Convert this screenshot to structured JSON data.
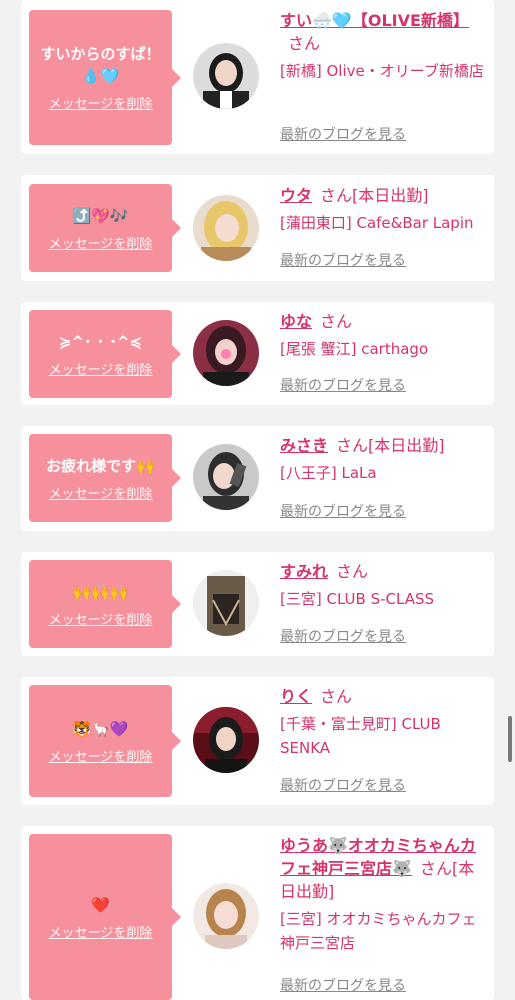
{
  "cards": [
    {
      "message": "すいからのすぱ！💧🩵",
      "delete_label": "メッセージを削除",
      "name": "すい🌨️🩵【OLIVE新橋】",
      "honorific": "さん",
      "tag": "",
      "shop": "[新橋] Olive・オリーブ新橋店",
      "blog_label": "最新のブログを見る"
    },
    {
      "message": "⤴️💖🎶",
      "delete_label": "メッセージを削除",
      "name": "ウタ",
      "honorific": "さん",
      "tag": "[本日出勤]",
      "shop": "[蒲田東口] Cafe&Bar Lapin",
      "blog_label": "最新のブログを見る"
    },
    {
      "message": "≽^･ ･ ･^≼",
      "delete_label": "メッセージを削除",
      "name": "ゆな",
      "honorific": "さん",
      "tag": "",
      "shop": "[尾張 蟹江] carthago",
      "blog_label": "最新のブログを見る"
    },
    {
      "message": "お疲れ様です🙌",
      "delete_label": "メッセージを削除",
      "name": "みさき",
      "honorific": "さん",
      "tag": "[本日出勤]",
      "shop": "[八王子] LaLa",
      "blog_label": "最新のブログを見る"
    },
    {
      "message": "🙌🙌🙌",
      "delete_label": "メッセージを削除",
      "name": "すみれ",
      "honorific": "さん",
      "tag": "",
      "shop": "[三宮] CLUB S-CLASS",
      "blog_label": "最新のブログを見る"
    },
    {
      "message": "🐯🦙💜",
      "delete_label": "メッセージを削除",
      "name": "りく",
      "honorific": "さん",
      "tag": "",
      "shop": "[千葉・富士見町] CLUB SENKA",
      "blog_label": "最新のブログを見る"
    },
    {
      "message": "❤️",
      "delete_label": "メッセージを削除",
      "name": "ゆうあ🐺オオカミちゃんカフェ神戸三宮店🐺",
      "honorific": "さん",
      "tag": "[本日出勤]",
      "shop": "[三宮] オオカミちゃんカフェ神戸三宮店",
      "blog_label": "最新のブログを見る"
    }
  ],
  "colors": {
    "accent": "#d6336c",
    "bubble": "#f7909d",
    "link_gray": "#888888",
    "background": "#f2f2f2"
  }
}
